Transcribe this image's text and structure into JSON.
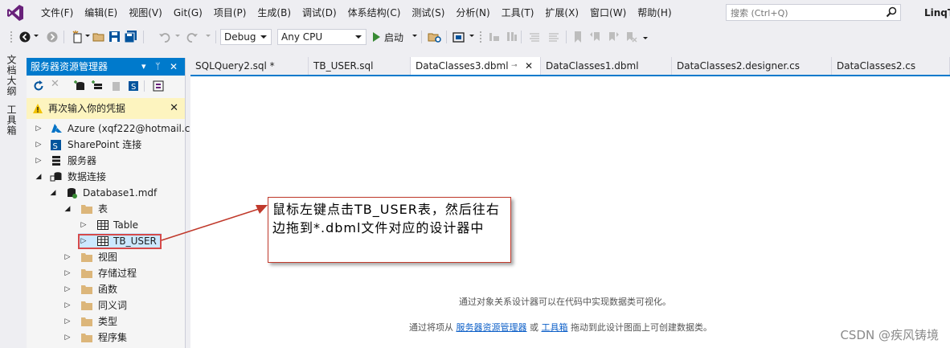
{
  "menubar": {
    "items": [
      "文件(F)",
      "编辑(E)",
      "视图(V)",
      "Git(G)",
      "项目(P)",
      "生成(B)",
      "调试(D)",
      "体系结构(C)",
      "测试(S)",
      "分析(N)",
      "工具(T)",
      "扩展(X)",
      "窗口(W)",
      "帮助(H)"
    ],
    "search_placeholder": "搜索 (Ctrl+Q)",
    "title": "LinqT"
  },
  "toolbar": {
    "config": "Debug",
    "platform": "Any CPU",
    "start_label": "启动"
  },
  "vstrip": {
    "doc_outline": "文档大纲",
    "toolbox": "工具箱"
  },
  "server_explorer": {
    "title": "服务器资源管理器",
    "pin_glyph": "▾ ⊥ ✕",
    "info_text": "再次输入你的凭据",
    "tree": [
      {
        "label": "Azure (xqf222@hotmail.c",
        "expander": "▷",
        "icon": "azure-icon"
      },
      {
        "label": "SharePoint 连接",
        "expander": "▷",
        "icon": "sharepoint-icon"
      },
      {
        "label": "服务器",
        "expander": "▷",
        "icon": "server-icon"
      },
      {
        "label": "数据连接",
        "expander": "◢",
        "icon": "data-connection-icon"
      },
      {
        "label": "Database1.mdf",
        "expander": "◢",
        "icon": "database-icon"
      },
      {
        "label": "表",
        "expander": "◢",
        "icon": "folder-icon"
      },
      {
        "label": "Table",
        "expander": "▷",
        "icon": "table-icon"
      },
      {
        "label": "TB_USER",
        "expander": "▷",
        "icon": "table-icon"
      },
      {
        "label": "视图",
        "expander": "▷",
        "icon": "folder-icon"
      },
      {
        "label": "存储过程",
        "expander": "▷",
        "icon": "folder-icon"
      },
      {
        "label": "函数",
        "expander": "▷",
        "icon": "folder-icon"
      },
      {
        "label": "同义词",
        "expander": "▷",
        "icon": "folder-icon"
      },
      {
        "label": "类型",
        "expander": "▷",
        "icon": "folder-icon"
      },
      {
        "label": "程序集",
        "expander": "▷",
        "icon": "folder-icon"
      }
    ]
  },
  "tabs": [
    {
      "label": "SQLQuery2.sql *"
    },
    {
      "label": "TB_USER.sql"
    },
    {
      "label": "DataClasses3.dbml"
    },
    {
      "label": "DataClasses1.dbml"
    },
    {
      "label": "DataClasses2.designer.cs"
    },
    {
      "label": "DataClasses2.cs"
    }
  ],
  "editor": {
    "hint1": "通过对象关系设计器可以在代码中实现数据类可视化。",
    "hint2_prefix": "通过将项从 ",
    "hint2_link1": "服务器资源管理器",
    "hint2_mid": " 或 ",
    "hint2_link2": "工具箱",
    "hint2_suffix": " 拖动到此设计图面上可创建数据类。"
  },
  "callout": {
    "text": "鼠标左键点击TB_USER表，然后往右边拖到*.dbml文件对应的设计器中"
  },
  "watermark": "CSDN @疾风铸境",
  "colors": {
    "accent": "#007acc",
    "selection": "#cce8ff",
    "annotation_red": "#c0392b",
    "infobar": "#fdf4bf"
  }
}
